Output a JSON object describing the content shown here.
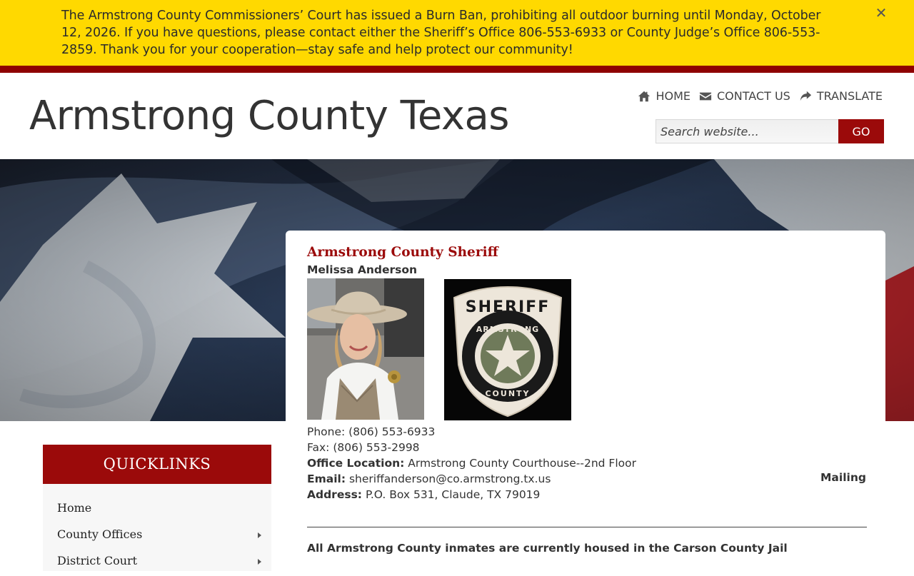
{
  "alert": {
    "message": "The Armstrong County Commissioners’ Court has issued a Burn Ban, prohibiting all outdoor burning until Monday, October 12, 2026. If you have questions, please contact either the Sheriff’s Office 806-553-6933 or County Judge’s Office 806-553-2859. Thank you for your cooperation—stay safe and help protect our community!",
    "close_glyph": "✕",
    "bg_color": "#ffd900",
    "rule_color": "#8e0101"
  },
  "header": {
    "site_title": "Armstrong County Texas",
    "nav": [
      {
        "label": "HOME",
        "icon": "home-icon"
      },
      {
        "label": "CONTACT US",
        "icon": "envelope-icon"
      },
      {
        "label": "TRANSLATE",
        "icon": "share-icon"
      }
    ],
    "search": {
      "placeholder": "Search website...",
      "button_label": "GO"
    }
  },
  "quicklinks": {
    "title": "QUICKLINKS",
    "items": [
      {
        "label": "Home",
        "has_submenu": false
      },
      {
        "label": "County Offices",
        "has_submenu": true
      },
      {
        "label": "District Court",
        "has_submenu": true
      }
    ]
  },
  "content": {
    "title": "Armstrong County Sheriff",
    "name": "Melissa Anderson",
    "patch": {
      "top_text": "SHERIFF",
      "ring_top": "ARMSTRONG",
      "ring_bottom": "COUNTY"
    },
    "phone": "Phone: (806) 553-6933",
    "fax": "Fax: (806) 553-2998",
    "office_location_label": "Office Location:",
    "office_location_value": "Armstrong County Courthouse--2nd Floor",
    "email_label": "Email:",
    "email_value": "sheriffanderson@co.armstrong.tx.us",
    "mailing_label": "Mailing",
    "address_label": "Address:",
    "address_value": "P.O. Box 531, Claude, TX 79019",
    "notice": "All Armstrong County inmates are currently housed in the Carson County Jail"
  },
  "colors": {
    "brand_red": "#9b0a0a",
    "accent_dark_red": "#8e0101"
  }
}
